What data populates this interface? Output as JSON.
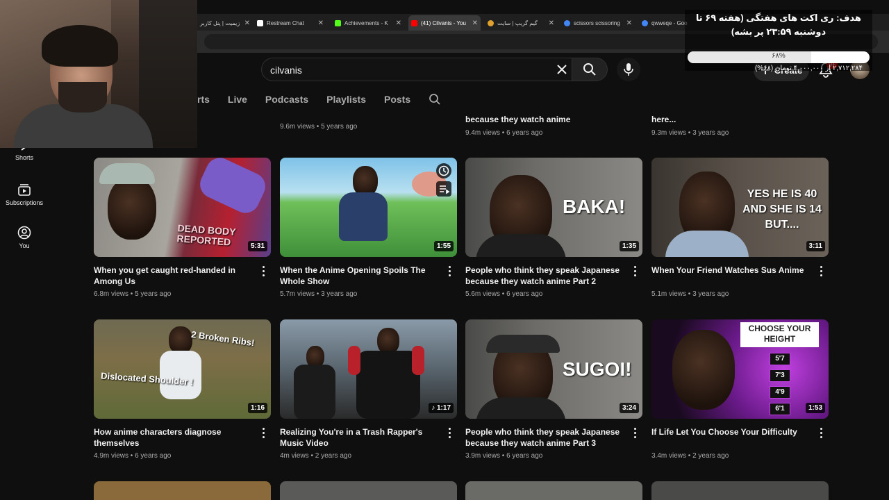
{
  "browser": {
    "tabs": [
      {
        "label": "زیمیت | پنل کاربر",
        "active": false
      },
      {
        "label": "Restream Chat",
        "active": false
      },
      {
        "label": "Achievements - K",
        "active": false
      },
      {
        "label": "(41) Cilvanis - You",
        "active": true
      },
      {
        "label": "گیم گریپ | سایت",
        "active": false
      },
      {
        "label": "scissors scissoring",
        "active": false
      },
      {
        "label": "qwweqe - Goo",
        "active": false
      }
    ]
  },
  "header": {
    "search_value": "cilvanis",
    "create_label": "Create",
    "notification_badge": "9+"
  },
  "channel_tabs": [
    "rts",
    "Live",
    "Podcasts",
    "Playlists",
    "Posts"
  ],
  "sidebar": {
    "items": [
      {
        "label": "Shorts"
      },
      {
        "label": "Subscriptions"
      },
      {
        "label": "You"
      }
    ]
  },
  "overlay": {
    "goal_title": "هدف: ری اکت های هفتگی (هفته ۶۹ تا دوشنبه ۲۳:۵۹ پر بشه)",
    "goal_percent": "۶۸%",
    "goal_progress": 0.68,
    "goal_amount": "۲,۷۱۲,۲۸۴ از ۴,۰۰۰,۰۰۰ تومان (۶۸%)"
  },
  "top_row": [
    {
      "title": "",
      "views": "9.6m views",
      "age": "5 years ago"
    },
    {
      "title": "because they watch anime",
      "views": "9.4m views",
      "age": "6 years ago"
    },
    {
      "title": "here...",
      "views": "9.3m views",
      "age": "3 years ago"
    }
  ],
  "videos": [
    {
      "title": "When you get caught red-handed in Among Us",
      "views": "6.8m views",
      "age": "5 years ago",
      "duration": "5:31",
      "thumb_text": "DEAD BODY REPORTED"
    },
    {
      "title": "When the Anime Opening Spoils The Whole Show",
      "views": "5.7m views",
      "age": "3 years ago",
      "duration": "1:55",
      "thumb_text": ""
    },
    {
      "title": "People who think they speak Japanese because they watch anime Part 2",
      "views": "5.6m views",
      "age": "6 years ago",
      "duration": "1:35",
      "thumb_text": "BAKA!"
    },
    {
      "title": "When Your Friend Watches Sus Anime",
      "views": "5.1m views",
      "age": "3 years ago",
      "duration": "3:11",
      "thumb_text": "YES HE IS 40 AND SHE IS 14 BUT...."
    },
    {
      "title": "How anime characters diagnose themselves",
      "views": "4.9m views",
      "age": "6 years ago",
      "duration": "1:16",
      "thumb_text": "2 Broken Ribs!",
      "thumb_text2": "Dislocated Shoulder !"
    },
    {
      "title": "Realizing You're in a Trash Rapper's Music Video",
      "views": "4m views",
      "age": "2 years ago",
      "duration": "1:17",
      "thumb_text": ""
    },
    {
      "title": "People who think they speak Japanese because they watch anime Part 3",
      "views": "3.9m views",
      "age": "6 years ago",
      "duration": "3:24",
      "thumb_text": "SUGOI!"
    },
    {
      "title": "If Life Let You Choose Your Difficulty",
      "views": "3.4m views",
      "age": "2 years ago",
      "duration": "1:53",
      "thumb_text": "CHOOSE YOUR HEIGHT",
      "heights": [
        "5'7",
        "7'3",
        "4'9",
        "6'1"
      ]
    }
  ],
  "colors": {
    "background": "#0f0f0f",
    "text_primary": "#f1f1f1",
    "text_secondary": "#aaaaaa",
    "notification_red": "#cc0000"
  }
}
